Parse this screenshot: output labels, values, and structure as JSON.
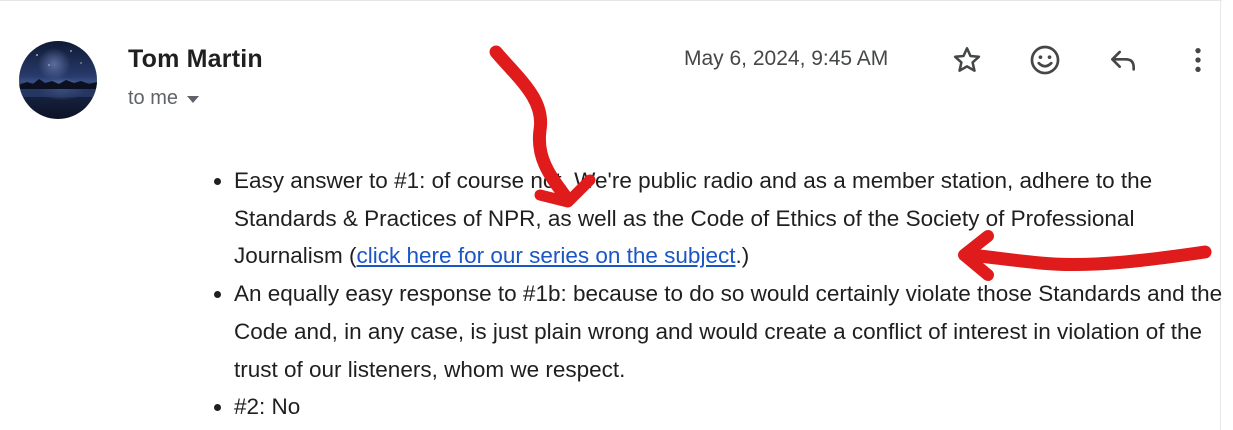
{
  "message": {
    "sender_name": "Tom Martin",
    "recipients_label": "to me",
    "date": "May 6, 2024, 9:45 AM",
    "avatar_icon": "landscape-photo-avatar",
    "actions": {
      "star": "star-icon",
      "react": "emoji-icon",
      "reply": "reply-icon",
      "more": "more-vert-icon"
    }
  },
  "body": {
    "item1_before_link": "Easy answer to #1: of course not. We're public radio and as a member station, adhere to the Standards & Practices of NPR, as well as the Code of Ethics of the Society of Professional Journalism (",
    "item1_link": "click here for our series on the subject",
    "item1_after_link": ".)",
    "item2": "An equally easy response to #1b: because to do so would certainly violate those Standards and the Code and, in any case, is just plain wrong and would create a conflict of interest in violation of the trust of our listeners, whom we respect.",
    "item3": "#2: No"
  },
  "colors": {
    "link": "#1a56c4",
    "annotation": "#e01b1b",
    "muted_text": "#5f6368"
  }
}
